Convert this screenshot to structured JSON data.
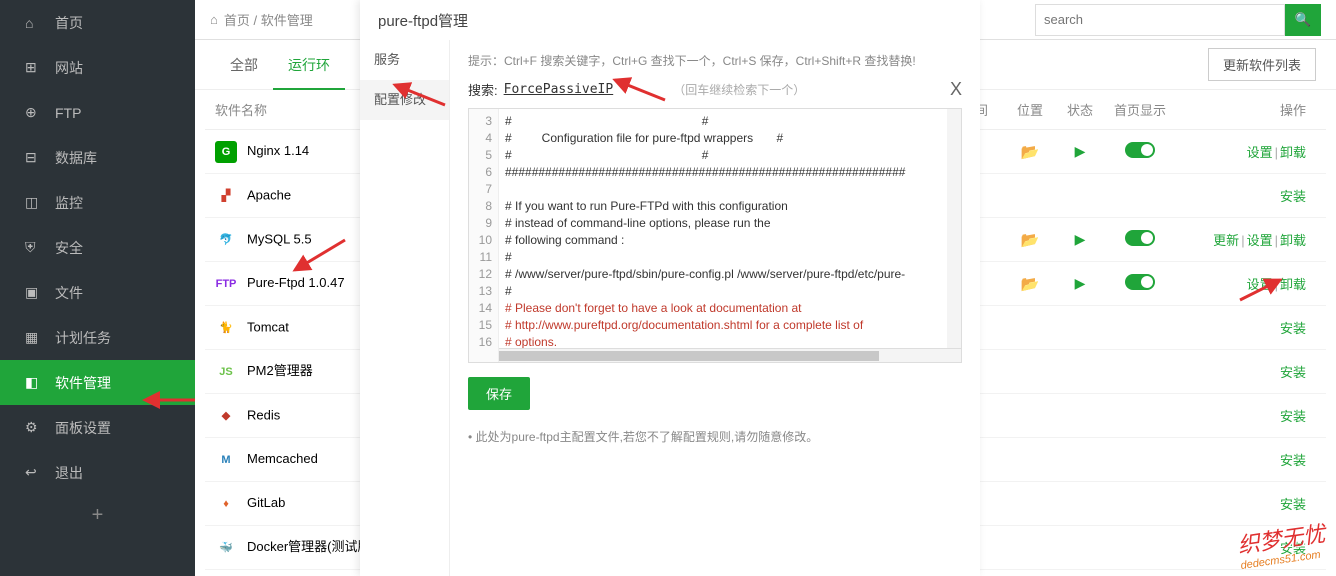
{
  "sidebar": {
    "items": [
      {
        "label": "首页",
        "icon": "⌂"
      },
      {
        "label": "网站",
        "icon": "⊞"
      },
      {
        "label": "FTP",
        "icon": "⊕"
      },
      {
        "label": "数据库",
        "icon": "⊟"
      },
      {
        "label": "监控",
        "icon": "◫"
      },
      {
        "label": "安全",
        "icon": "⛨"
      },
      {
        "label": "文件",
        "icon": "▣"
      },
      {
        "label": "计划任务",
        "icon": "▦"
      },
      {
        "label": "软件管理",
        "icon": "◧",
        "active": true
      },
      {
        "label": "面板设置",
        "icon": "⚙"
      },
      {
        "label": "退出",
        "icon": "↩"
      }
    ],
    "plus": "+"
  },
  "breadcrumb": {
    "home": "⌂",
    "items": [
      "首页",
      "软件管理"
    ],
    "sep": " / "
  },
  "search": {
    "placeholder": "search",
    "icon": "🔍"
  },
  "tabs": {
    "items": [
      "全部",
      "运行环"
    ],
    "active": 1,
    "update_btn": "更新软件列表"
  },
  "table": {
    "headers": {
      "name": "软件名称",
      "time": "时间",
      "pos": "位置",
      "status": "状态",
      "home": "首页显示",
      "op": "操作"
    },
    "rows": [
      {
        "icon_bg": "#00a000",
        "icon_fg": "#fff",
        "icon_txt": "G",
        "name": "Nginx 1.14",
        "folder": true,
        "play": true,
        "toggle": true,
        "ops": [
          "设置",
          "卸载"
        ]
      },
      {
        "icon_bg": "#fff",
        "icon_fg": "#d0402f",
        "icon_txt": "▞",
        "name": "Apache",
        "ops": [
          "安装"
        ]
      },
      {
        "icon_bg": "#fff",
        "icon_fg": "#3a6ea5",
        "icon_txt": "🐬",
        "name": "MySQL 5.5",
        "folder": true,
        "play": true,
        "toggle": true,
        "ops": [
          "更新",
          "设置",
          "卸载"
        ]
      },
      {
        "icon_bg": "#fff",
        "icon_fg": "#8a2be2",
        "icon_txt": "FTP",
        "name": "Pure-Ftpd 1.0.47",
        "folder": true,
        "play": true,
        "toggle": true,
        "ops": [
          "设置",
          "卸载"
        ]
      },
      {
        "icon_bg": "#fff",
        "icon_fg": "#d6a741",
        "icon_txt": "🐈",
        "name": "Tomcat",
        "ops": [
          "安装"
        ]
      },
      {
        "icon_bg": "#fff",
        "icon_fg": "#6cc24a",
        "icon_txt": "JS",
        "name": "PM2管理器",
        "ops": [
          "安装"
        ]
      },
      {
        "icon_bg": "#fff",
        "icon_fg": "#c0392b",
        "icon_txt": "◆",
        "name": "Redis",
        "ops": [
          "安装"
        ]
      },
      {
        "icon_bg": "#fff",
        "icon_fg": "#2980b9",
        "icon_txt": "M",
        "name": "Memcached",
        "ops": [
          "安装"
        ]
      },
      {
        "icon_bg": "#fff",
        "icon_fg": "#e0632c",
        "icon_txt": "♦",
        "name": "GitLab",
        "ops": [
          "安装"
        ]
      },
      {
        "icon_bg": "#fff",
        "icon_fg": "#2496ed",
        "icon_txt": "🐳",
        "name": "Docker管理器(测试版)",
        "ops": [
          "安装"
        ]
      }
    ]
  },
  "modal": {
    "title": "pure-ftpd管理",
    "tabs": [
      "服务",
      "配置修改"
    ],
    "active_tab": 1,
    "hint": "提示：Ctrl+F 搜索关键字，Ctrl+G 查找下一个，Ctrl+S 保存，Ctrl+Shift+R 查找替换!",
    "search_label": "搜索:",
    "search_value": "ForcePassiveIP",
    "search_hint": "（回车继续检索下一个）",
    "close": "X",
    "lines_start": 3,
    "code_lines": [
      "#                                                         #",
      "#         Configuration file for pure-ftpd wrappers       #",
      "#                                                         #",
      "############################################################",
      "",
      "# If you want to run Pure-FTPd with this configuration",
      "# instead of command-line options, please run the",
      "# following command :",
      "#",
      "# /www/server/pure-ftpd/sbin/pure-config.pl /www/server/pure-ftpd/etc/pure-",
      "#",
      "# Please don't forget to have a look at documentation at",
      "# http://www.pureftpd.org/documentation.shtml for a complete list of",
      "# options."
    ],
    "red_line_indexes": [
      11,
      12,
      13
    ],
    "save": "保存",
    "note": "此处为pure-ftpd主配置文件,若您不了解配置规则,请勿随意修改。"
  },
  "watermark": {
    "text": "织梦无忧",
    "url": "dedecms51.com"
  }
}
